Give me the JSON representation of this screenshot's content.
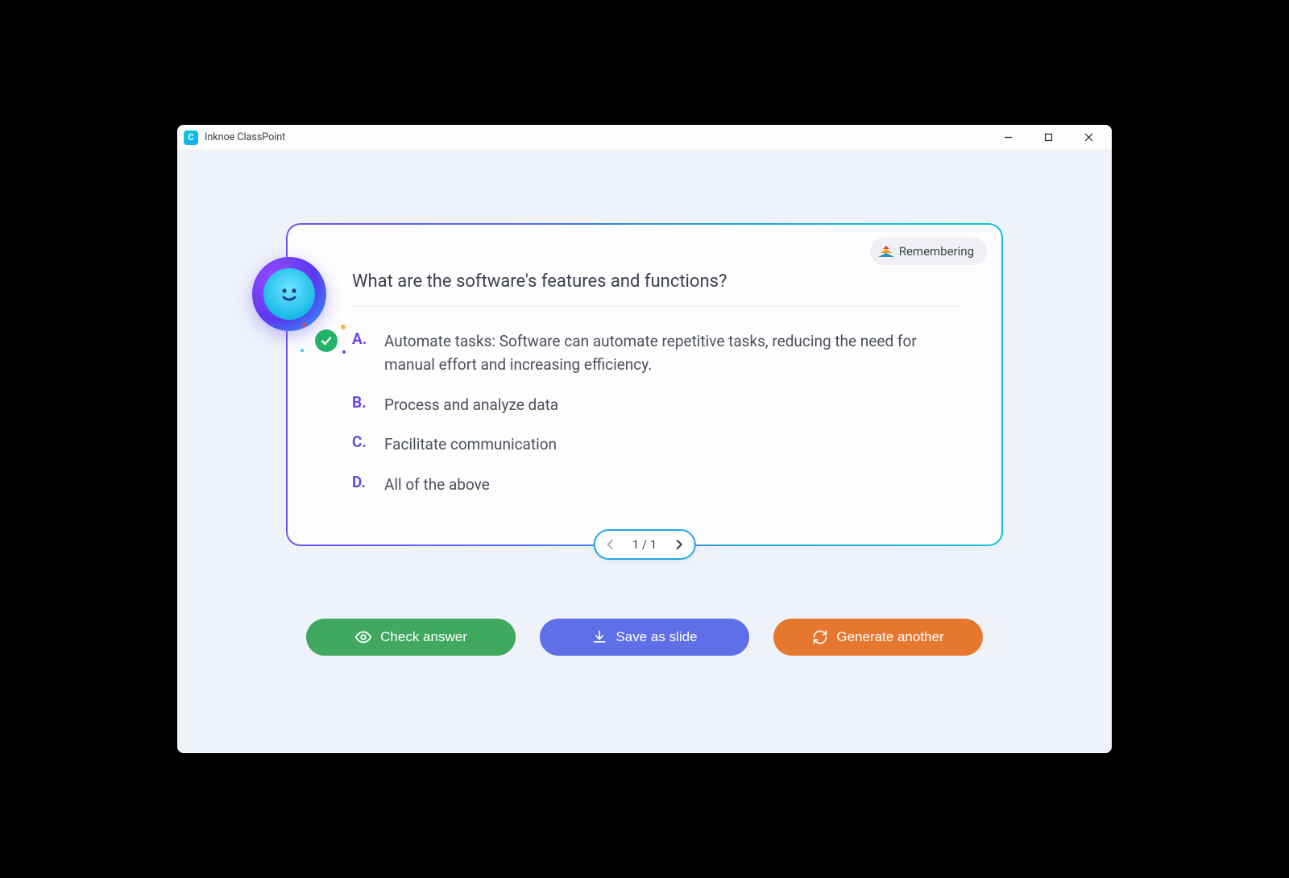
{
  "window": {
    "title": "Inknoe ClassPoint",
    "app_icon_letter": "C"
  },
  "badge": {
    "label": "Remembering"
  },
  "question": "What are the software's features and functions?",
  "options": [
    {
      "letter": "A.",
      "text": "Automate tasks: Software can automate repetitive tasks, reducing the need for manual effort and increasing efficiency.",
      "correct": true
    },
    {
      "letter": "B.",
      "text": "Process and analyze data",
      "correct": false
    },
    {
      "letter": "C.",
      "text": "Facilitate communication",
      "correct": false
    },
    {
      "letter": "D.",
      "text": "All of the above",
      "correct": false
    }
  ],
  "pager": {
    "current": 1,
    "total": 1,
    "display": "1 / 1"
  },
  "buttons": {
    "check": "Check answer",
    "save": "Save as slide",
    "generate": "Generate another"
  },
  "colors": {
    "green_btn": "#41a85f",
    "blue_btn": "#5f6fe8",
    "orange_btn": "#e6772e",
    "option_letter": "#6b49e6",
    "correct_badge": "#22b36b"
  }
}
